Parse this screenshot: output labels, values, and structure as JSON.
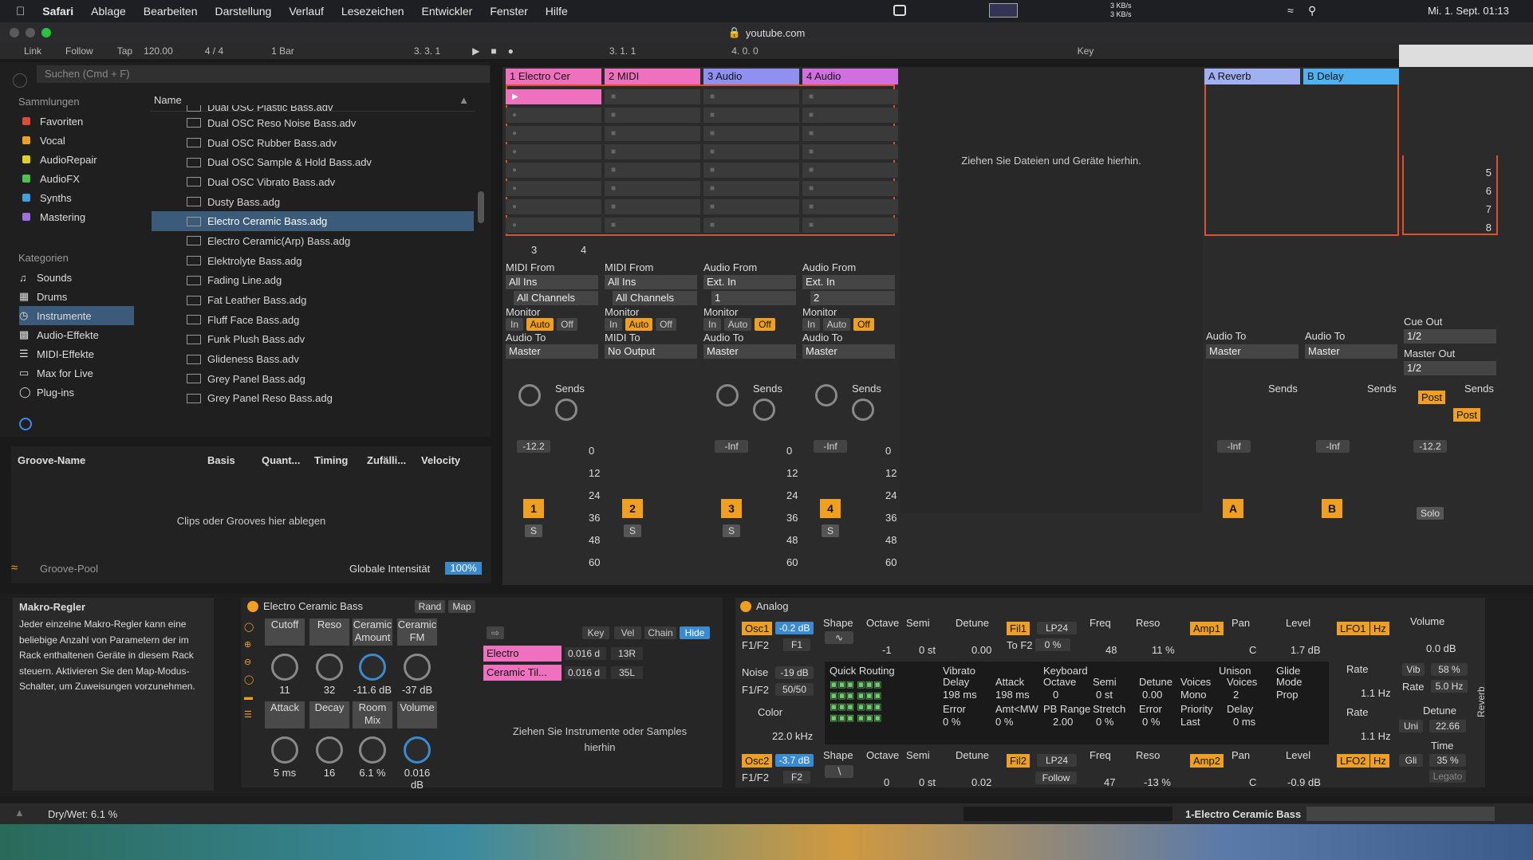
{
  "menubar": {
    "app": "Safari",
    "items": [
      "Ablage",
      "Bearbeiten",
      "Darstellung",
      "Verlauf",
      "Lesezeichen",
      "Entwickler",
      "Fenster",
      "Hilfe"
    ],
    "net_up": "3 KB/s",
    "net_down": "3 KB/s",
    "clock": "Mi. 1. Sept. 01:13"
  },
  "tab": {
    "url": "youtube.com"
  },
  "transport": {
    "link": "Link",
    "follow": "Follow",
    "tap": "Tap",
    "tempo": "120.00",
    "signature": "4 / 4",
    "quant": "1 Bar",
    "position": "3.  3.  1",
    "loop_start": "3.  1.  1",
    "loop_len": "4.  0.  0",
    "key": "Key"
  },
  "browser": {
    "search_placeholder": "Suchen (Cmd + F)",
    "collections_title": "Sammlungen",
    "collections": [
      {
        "label": "Favoriten",
        "color": "#e04a3a"
      },
      {
        "label": "Vocal",
        "color": "#f0a020"
      },
      {
        "label": "AudioRepair",
        "color": "#e0d020"
      },
      {
        "label": "AudioFX",
        "color": "#50c050"
      },
      {
        "label": "Synths",
        "color": "#40a0e0"
      },
      {
        "label": "Mastering",
        "color": "#a070e0"
      }
    ],
    "categories_title": "Kategorien",
    "categories": [
      "Sounds",
      "Drums",
      "Instrumente",
      "Audio-Effekte",
      "MIDI-Effekte",
      "Max for Live",
      "Plug-ins"
    ],
    "name_col": "Name",
    "files": [
      "Dual OSC Plastic Bass.adv",
      "Dual OSC Reso Noise Bass.adv",
      "Dual OSC Rubber Bass.adv",
      "Dual OSC Sample & Hold Bass.adv",
      "Dual OSC Vibrato Bass.adv",
      "Dusty Bass.adg",
      "Electro Ceramic Bass.adg",
      "Electro Ceramic(Arp) Bass.adg",
      "Elektrolyte Bass.adg",
      "Fading Line.adg",
      "Fat Leather Bass.adg",
      "Fluff Face Bass.adg",
      "Funk Plush Bass.adv",
      "Glideness Bass.adv",
      "Grey Panel Bass.adg",
      "Grey Panel Reso Bass.adg"
    ]
  },
  "groove": {
    "cols": [
      "Groove-Name",
      "Basis",
      "Quant...",
      "Timing",
      "Zufälli...",
      "Velocity"
    ],
    "drop_hint": "Clips oder Grooves hier ablegen",
    "pool": "Groove-Pool",
    "intensity_label": "Globale Intensität",
    "intensity": "100%"
  },
  "tracks": [
    {
      "name": "1 Electro Cer",
      "color": "#f070c0",
      "from": "MIDI From",
      "src": "All Ins",
      "ch": "All Channels",
      "to": "Master",
      "vol": "-12.2",
      "num": "1"
    },
    {
      "name": "2 MIDI",
      "color": "#f070c0",
      "from": "MIDI From",
      "src": "All Ins",
      "ch": "All Channels",
      "to": "No Output",
      "vol": "",
      "num": "2"
    },
    {
      "name": "3 Audio",
      "color": "#9090f0",
      "from": "Audio From",
      "src": "Ext. In",
      "ch": "1",
      "to": "Master",
      "vol": "-Inf",
      "num": "3"
    },
    {
      "name": "4 Audio",
      "color": "#d070e0",
      "from": "Audio From",
      "src": "Ext. In",
      "ch": "2",
      "to": "Master",
      "vol": "-Inf",
      "num": "4"
    }
  ],
  "returns": [
    {
      "name": "A Reverb",
      "color": "#a0b0f0",
      "vol": "-Inf",
      "num": "A"
    },
    {
      "name": "B Delay",
      "color": "#50b0f0",
      "vol": "-Inf",
      "num": "B"
    }
  ],
  "session": {
    "drop_hint": "Ziehen Sie Dateien und Geräte hierhin.",
    "monitor": "Monitor",
    "audio_to": "Audio To",
    "midi_to": "MIDI To",
    "sends": "Sends",
    "mon_in": "In",
    "mon_auto": "Auto",
    "mon_off": "Off",
    "cue_out": "Cue Out",
    "cue_val": "1/2",
    "master_out": "Master Out",
    "master_val": "1/2",
    "master_vol": "-12.2",
    "solo": "Solo",
    "post": "Post",
    "scale": [
      "0",
      "12",
      "24",
      "36",
      "48",
      "60"
    ],
    "scene_nums": [
      "5",
      "6",
      "7",
      "8"
    ],
    "launch_a": "3",
    "launch_b": "4"
  },
  "macro_info": {
    "title": "Makro-Regler",
    "text": "Jeder einzelne Makro-Regler kann eine beliebige Anzahl von Parametern der im Rack enthaltenen Geräte in diesem Rack steuern. Aktivieren Sie den Map-Modus-Schalter, um Zuweisungen vorzunehmen."
  },
  "rack": {
    "title": "Electro Ceramic Bass",
    "rand": "Rand",
    "map": "Map",
    "macros": [
      {
        "label": "Cutoff",
        "value": "11"
      },
      {
        "label": "Reso",
        "value": "32"
      },
      {
        "label": "Ceramic Amount",
        "value": "-11.6 dB"
      },
      {
        "label": "Ceramic FM",
        "value": "-37 dB"
      },
      {
        "label": "Attack",
        "value": "5 ms"
      },
      {
        "label": "Decay",
        "value": "16"
      },
      {
        "label": "Room Mix",
        "value": "6.1 %"
      },
      {
        "label": "Volume",
        "value": "0.016 dB"
      }
    ],
    "chain_cols": [
      "Key",
      "Vel",
      "Chain",
      "Hide"
    ],
    "chains": [
      {
        "name": "Electro",
        "vol": "0.016 d",
        "pan": "13R"
      },
      {
        "name": "Ceramic Til...",
        "vol": "0.016 d",
        "pan": "35L"
      }
    ],
    "drop_hint": "Ziehen Sie Instrumente oder Samples hierhin"
  },
  "analog": {
    "title": "Analog",
    "osc1": "Osc1",
    "osc1_lvl": "-0.2 dB",
    "f1f2": "F1/F2",
    "f1": "F1",
    "shape": "Shape",
    "octave": "Octave",
    "semi": "Semi",
    "detune": "Detune",
    "oct1": "-1",
    "semi1": "0 st",
    "det1": "0.00",
    "fil1": "Fil1",
    "lp24": "LP24",
    "freq": "Freq",
    "reso": "Reso",
    "to_f2": "To F2",
    "to_f2_v": "0 %",
    "freq1": "48",
    "reso1": "11 %",
    "amp1": "Amp1",
    "pan": "Pan",
    "level": "Level",
    "pan1": "C",
    "lvl1": "1.7 dB",
    "lfo1": "LFO1",
    "hz": "Hz",
    "noise": "Noise",
    "noise_lvl": "-19 dB",
    "nf": "50/50",
    "color": "Color",
    "color_v": "22.0 kHz",
    "qr": "Quick Routing",
    "vib_hdr": [
      "Vibrato",
      "Keyboard",
      "Unison",
      "Glide"
    ],
    "vib": [
      "Delay",
      "Attack",
      "Octave",
      "Semi",
      "Detune",
      "Voices",
      "Voices",
      "Mode"
    ],
    "vib_v": [
      "198 ms",
      "198 ms",
      "0",
      "0 st",
      "0.00",
      "Mono",
      "2",
      "Prop"
    ],
    "err": [
      "Error",
      "Amt<MW",
      "PB Range",
      "Stretch",
      "Error",
      "Priority",
      "Delay"
    ],
    "err_v": [
      "0 %",
      "0 %",
      "2.00",
      "0 %",
      "0 %",
      "Last",
      "0 ms"
    ],
    "osc2": "Osc2",
    "osc2_lvl": "-3.7 dB",
    "f2": "F2",
    "oct2": "0",
    "semi2": "0 st",
    "det2": "0.02",
    "fil2": "Fil2",
    "follow": "Follow",
    "freq2": "47",
    "reso2": "-13 %",
    "amp2": "Amp2",
    "pan2": "C",
    "lvl2": "-0.9 dB",
    "lfo2": "LFO2",
    "rate": "Rate",
    "rate1": "1.1 Hz",
    "rate2": "1.1 Hz",
    "volume": "Volume",
    "vol_v": "0.0 dB",
    "vib_l": "Vib",
    "vib_p": "58 %",
    "rate_l": "Rate",
    "rate_v": "5.0 Hz",
    "detune_l": "Detune",
    "uni": "Uni",
    "uni_v": "22.66",
    "time": "Time",
    "gli": "Gli",
    "gli_v": "35 %",
    "legato": "Legato",
    "reverb": "Reverb"
  },
  "status": {
    "drywet": "Dry/Wet: 6.1 %",
    "track": "1-Electro Ceramic Bass"
  }
}
